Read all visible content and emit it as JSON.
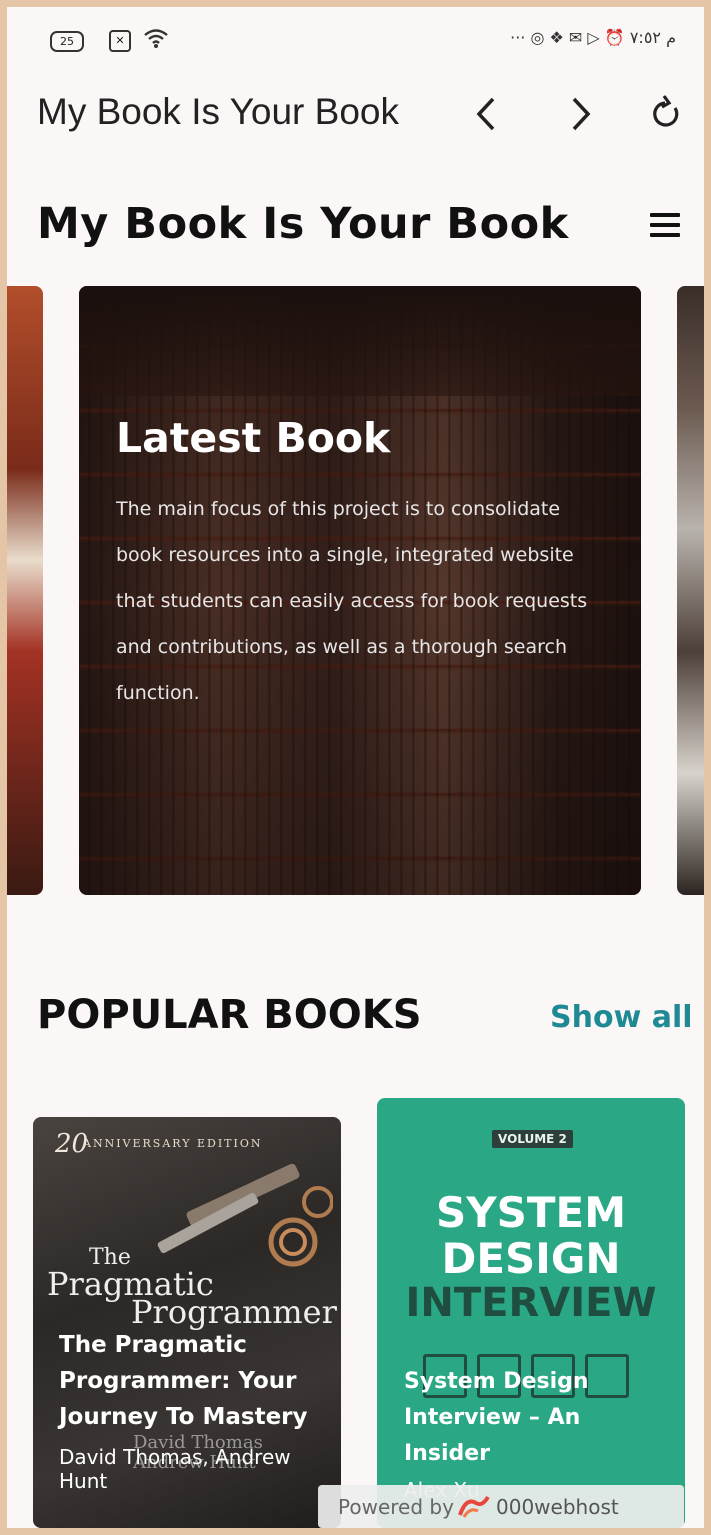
{
  "status_bar": {
    "battery": "25",
    "right_text": "··· ◎ ❖ ✉ ▷ ⏰ م ٧:٥٢"
  },
  "browser": {
    "title": "My Book Is Your Book"
  },
  "site": {
    "title": "My Book Is Your Book"
  },
  "hero": {
    "title": "Latest Book",
    "text": "The main focus of this project is to consolidate book resources into a single, integrated website that students can easily access for book requests and contributions, as well as a thorough search function."
  },
  "popular": {
    "title": "POPULAR BOOKS",
    "show_all": "Show all",
    "books": [
      {
        "title": "The Pragmatic Programmer: Your Journey To Mastery",
        "author": "David Thomas, Andrew Hunt",
        "cover_top": "20",
        "cover_anniv": "ANNIVERSARY EDITION",
        "cover_the": "The",
        "cover_line1": "Pragmatic",
        "cover_line2": "Programmer",
        "cover_author": "David Thomas\nAndrew Hunt"
      },
      {
        "title": "System Design Interview – An Insider",
        "author": "Alex Xu",
        "cover_volume": "VOLUME 2",
        "cover_line1": "SYSTEM",
        "cover_line2": "DESIGN",
        "cover_line3": "INTERVIEW"
      }
    ]
  },
  "footer": {
    "powered_label": "Powered by",
    "brand": "000webhost"
  },
  "colors": {
    "accent": "#1f8a94",
    "book2_bg": "#2aa784",
    "page_frame": "#e4c6a6"
  }
}
